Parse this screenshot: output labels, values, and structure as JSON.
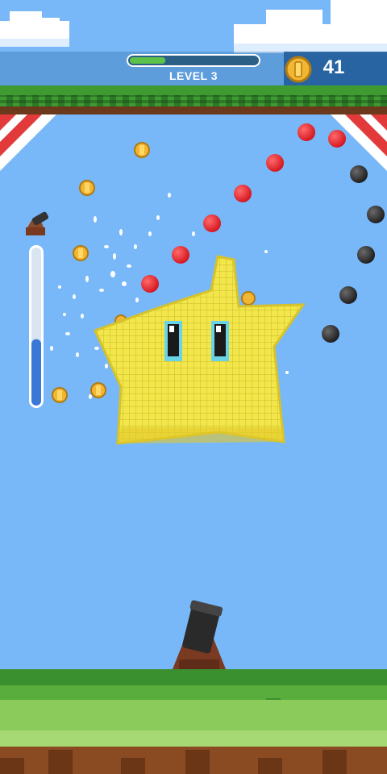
{
  "hud": {
    "level_label": "LEVEL 3",
    "level_progress": 0.28,
    "coin_count": "41"
  },
  "power_meter": {
    "level": 0.42
  },
  "colors": {
    "sky": "#78b8f8",
    "grass_dark": "#3a8f2e",
    "grass_light": "#6cc04a",
    "dirt": "#8a4a22",
    "star": "#f2e64a",
    "coin": "#f2b632",
    "ball_red": "#e8222c",
    "ball_black": "#2a2a2a",
    "meter_fill": "#3a78d8"
  },
  "icons": [
    "coin-icon",
    "mini-cannon-icon",
    "cannon",
    "star-character"
  ]
}
